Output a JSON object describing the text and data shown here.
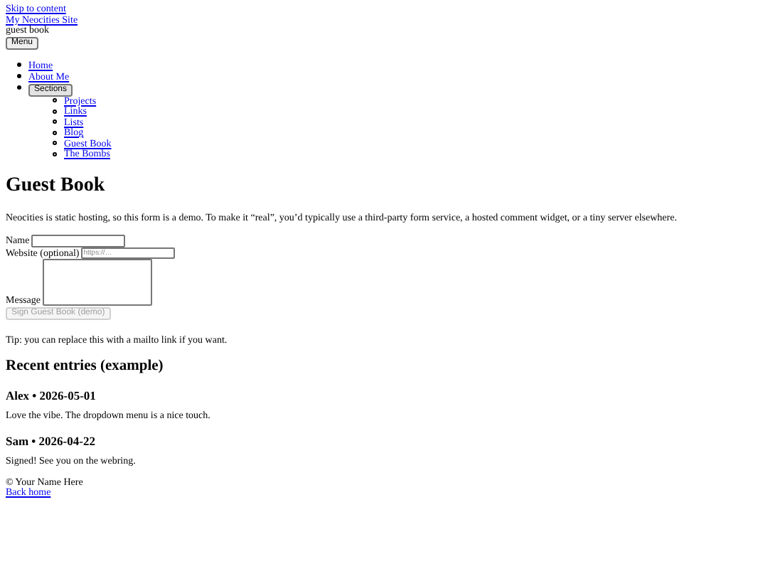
{
  "skip_link": "Skip to content",
  "site_title": "My Neocities Site",
  "page_label": "guest book",
  "menu_button": "Menu",
  "nav": [
    {
      "kind": "link",
      "label": "Home"
    },
    {
      "kind": "link",
      "label": "About Me"
    },
    {
      "kind": "dropdown",
      "label": "Sections",
      "expanded": true,
      "children": [
        {
          "label": "Projects"
        },
        {
          "label": "Links"
        },
        {
          "label": "Lists"
        },
        {
          "label": "Blog"
        },
        {
          "label": "Guest Book"
        },
        {
          "label": "The Bombs"
        }
      ]
    }
  ],
  "heading": "Guest Book",
  "intro": "Neocities is static hosting, so this form is a demo. To make it “real”, you’d typically use a third-party form service, a hosted comment widget, or a tiny server elsewhere.",
  "form": {
    "fields": [
      {
        "kind": "input",
        "label": "Name"
      },
      {
        "kind": "input",
        "label": "Website (optional)",
        "placeholder": "https://…"
      },
      {
        "kind": "textarea",
        "label": "Message"
      }
    ],
    "submit": {
      "label": "Sign Guest Book (demo)",
      "disabled": true
    }
  },
  "tip": "Tip: you can replace this with a mailto link if you want.",
  "entries_heading": "Recent entries (example)",
  "entries": [
    {
      "title": "Alex • 2026-05-01",
      "text": "Love the vibe. The dropdown menu is a nice touch."
    },
    {
      "title": "Sam • 2026-04-22",
      "text": "Signed! See you on the webring."
    }
  ],
  "footer": {
    "copyright": "© Your Name Here",
    "back_link": "Back home"
  }
}
